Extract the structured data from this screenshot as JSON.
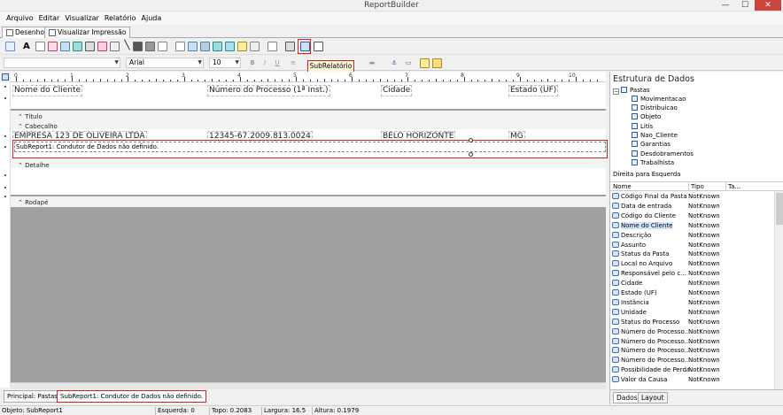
{
  "window": {
    "title": "ReportBuilder",
    "min": "—",
    "max": "☐",
    "close": "✕"
  },
  "menu": [
    "Arquivo",
    "Editar",
    "Visualizar",
    "Relatório",
    "Ajuda"
  ],
  "tabs": {
    "design": "Desenho",
    "preview": "Visualizar Impressão"
  },
  "format_bar": {
    "font": "Arial",
    "size": "10",
    "bold": "B",
    "italic": "I",
    "underline": "U"
  },
  "tooltip": "SubRelatório",
  "ruler": [
    "0",
    "1",
    "2",
    "3",
    "4",
    "5",
    "6",
    "7",
    "8",
    "9",
    "10"
  ],
  "bands": {
    "title": "Título",
    "header": "Cabeçalho",
    "detail": "Detalhe",
    "footer": "Rodapé"
  },
  "header_fields": [
    "Nome do Cliente",
    "Número do Processo (1ª Inst.)",
    "Cidade",
    "Estado (UF)"
  ],
  "data_fields": [
    "EMPRESA 123 DE OLIVEIRA LTDA",
    "12345-67.2009.813.0024",
    "BELO HORIZONTE",
    "MG"
  ],
  "subreport_text": "SubReport1: Condutor de Dados não definido.",
  "bottom_tabs": [
    "Principal: Pastas",
    "SubReport1: Condutor de Dados não definido."
  ],
  "status": {
    "object": "Objeto: SubReport1",
    "left": "Esquerda: 0",
    "top": "Topo: 0.2083",
    "width": "Largura: 16.5",
    "height": "Altura: 0.1979"
  },
  "data_tree": {
    "title": "Estrutura de Dados",
    "root": "Pastas",
    "children": [
      "Movimentacao",
      "Distribuicao",
      "Objeto",
      "Litis",
      "Nao_Cliente",
      "Garantias",
      "Desdobramentos",
      "Trabalhista"
    ]
  },
  "direction_label": "Direita para Esquerda",
  "fields_columns": {
    "name": "Nome",
    "type": "Tipo",
    "size": "Ta..."
  },
  "fields": [
    {
      "name": "Código Final da Pasta",
      "type": "NotKnown"
    },
    {
      "name": "Data de entrada",
      "type": "NotKnown"
    },
    {
      "name": "Código do Cliente",
      "type": "NotKnown"
    },
    {
      "name": "Nome do Cliente",
      "type": "NotKnown"
    },
    {
      "name": "Descrição",
      "type": "NotKnown"
    },
    {
      "name": "Assunto",
      "type": "NotKnown"
    },
    {
      "name": "Status da Pasta",
      "type": "NotKnown"
    },
    {
      "name": "Local no Arquivo",
      "type": "NotKnown"
    },
    {
      "name": "Responsável pelo c...",
      "type": "NotKnown"
    },
    {
      "name": "Cidade",
      "type": "NotKnown"
    },
    {
      "name": "Estado (UF)",
      "type": "NotKnown"
    },
    {
      "name": "Instância",
      "type": "NotKnown"
    },
    {
      "name": "Unidade",
      "type": "NotKnown"
    },
    {
      "name": "Status do Processo",
      "type": "NotKnown"
    },
    {
      "name": "Número do Processo...",
      "type": "NotKnown"
    },
    {
      "name": "Número do Processo...",
      "type": "NotKnown"
    },
    {
      "name": "Número do Processo...",
      "type": "NotKnown"
    },
    {
      "name": "Número do Processo...",
      "type": "NotKnown"
    },
    {
      "name": "Possibilidade de Perda",
      "type": "NotKnown"
    },
    {
      "name": "Valor da Causa",
      "type": "NotKnown"
    }
  ],
  "panel_tabs": [
    "Dados",
    "Layout"
  ],
  "colors": {
    "highlight": "#d02020",
    "band_gray": "#a0a0a0",
    "tooltip_bg": "#fff8dc"
  }
}
